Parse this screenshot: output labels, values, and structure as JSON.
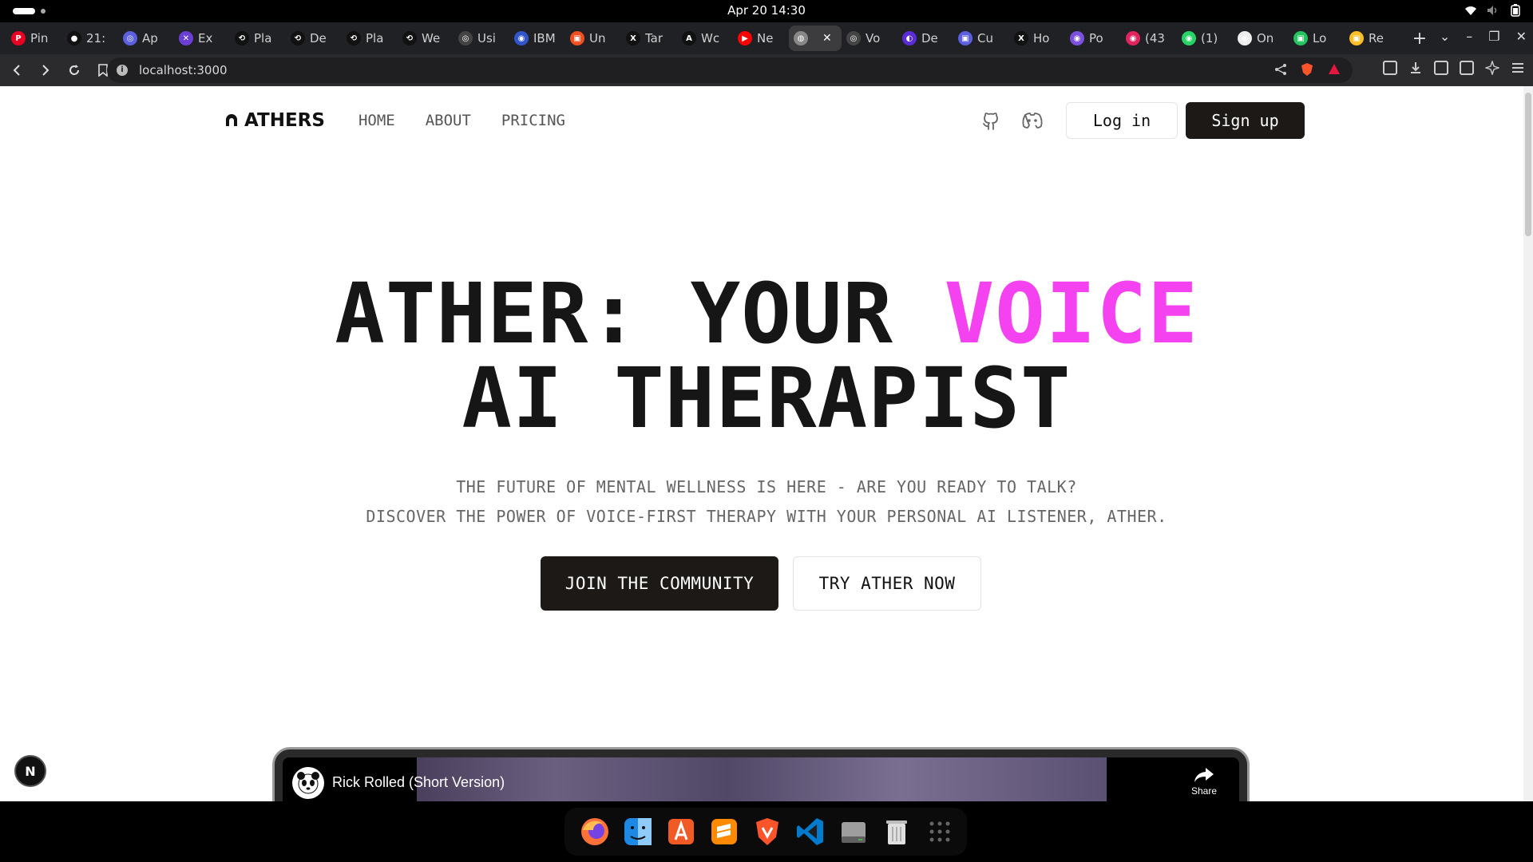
{
  "os": {
    "clock": "Apr 20  14:30"
  },
  "browser": {
    "tabs": [
      {
        "label": "Pin",
        "color": "#e60023",
        "glyph": "P"
      },
      {
        "label": "21:",
        "color": "#111111",
        "glyph": "●"
      },
      {
        "label": "Ap",
        "color": "#5b5fe0",
        "glyph": "◎"
      },
      {
        "label": "Ex",
        "color": "#6b3fd6",
        "glyph": "✕"
      },
      {
        "label": "Pla",
        "color": "#111111",
        "glyph": "⟲"
      },
      {
        "label": "De",
        "color": "#111111",
        "glyph": "⟲"
      },
      {
        "label": "Pla",
        "color": "#111111",
        "glyph": "⟲"
      },
      {
        "label": "We",
        "color": "#111111",
        "glyph": "⟲"
      },
      {
        "label": "Usi",
        "color": "#444444",
        "glyph": "◎"
      },
      {
        "label": "IBM",
        "color": "#3355cc",
        "glyph": "◉"
      },
      {
        "label": "Un",
        "color": "#f24e1e",
        "glyph": "▣"
      },
      {
        "label": "Tar",
        "color": "#111111",
        "glyph": "X"
      },
      {
        "label": "Wc",
        "color": "#111111",
        "glyph": "A"
      },
      {
        "label": "Ne",
        "color": "#ff0000",
        "glyph": "▶"
      },
      {
        "label": "",
        "color": "#888888",
        "glyph": "◍",
        "active": true
      },
      {
        "label": "Vo",
        "color": "#444444",
        "glyph": "◎"
      },
      {
        "label": "De",
        "color": "#5b2bd6",
        "glyph": "◐"
      },
      {
        "label": "Cu",
        "color": "#5b5fe0",
        "glyph": "▣"
      },
      {
        "label": "Ho",
        "color": "#111111",
        "glyph": "X"
      },
      {
        "label": "Po",
        "color": "#7b4fe0",
        "glyph": "◉"
      },
      {
        "label": "(43",
        "color": "#e0245e",
        "glyph": "◉"
      },
      {
        "label": "(1)",
        "color": "#25d366",
        "glyph": "◉"
      },
      {
        "label": "On",
        "color": "#eeeeee",
        "glyph": "◉"
      },
      {
        "label": "Lo",
        "color": "#22c55e",
        "glyph": "▣"
      },
      {
        "label": "Re",
        "color": "#fbbf24",
        "glyph": "▣"
      }
    ],
    "new_tab": "+",
    "url": "localhost:3000"
  },
  "site": {
    "brand": "ATHERS",
    "nav": {
      "home": "HOME",
      "about": "ABOUT",
      "pricing": "PRICING"
    },
    "login": "Log in",
    "signup": "Sign up",
    "hero": {
      "title_part1": "ATHER: YOUR ",
      "title_accent": "VOICE",
      "title_line2": "AI THERAPIST",
      "sub_line1": "THE FUTURE OF MENTAL WELLNESS IS HERE - ARE YOU READY TO TALK?",
      "sub_line2": "DISCOVER THE POWER OF VOICE-FIRST THERAPY WITH YOUR PERSONAL AI LISTENER, ATHER.",
      "cta_primary": "JOIN THE COMMUNITY",
      "cta_secondary": "TRY ATHER NOW"
    },
    "video": {
      "title": "Rick Rolled (Short Version)",
      "share": "Share"
    },
    "next_badge": "N"
  },
  "colors": {
    "accent": "#f542f0",
    "dark_button": "#1c1917"
  }
}
